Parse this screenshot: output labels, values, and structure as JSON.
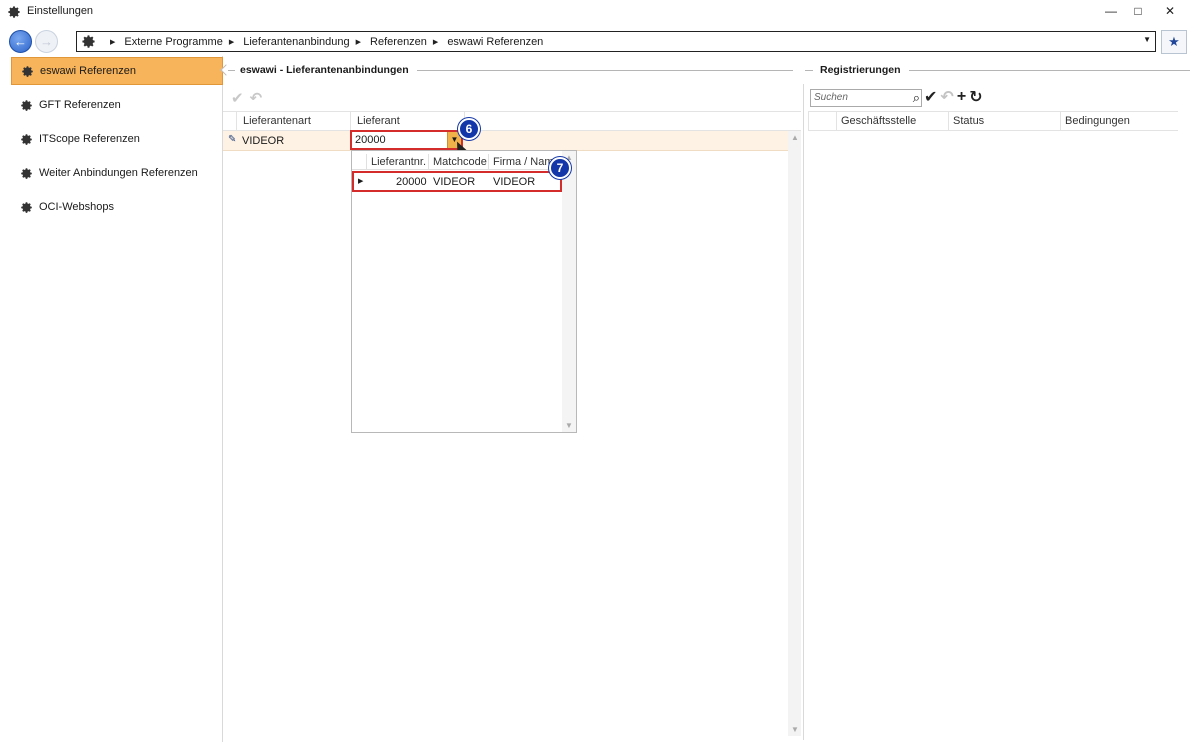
{
  "window": {
    "title": "Einstellungen",
    "minimize": "—",
    "maximize": "□",
    "close": "✕"
  },
  "nav": {
    "back_symbol": "←",
    "forward_symbol": "→",
    "breadcrumb": [
      "Externe Programme",
      "Lieferantenanbindung",
      "Referenzen",
      "eswawi Referenzen"
    ],
    "separator": "▶",
    "dropdown_symbol": "▼",
    "favorite_symbol": "★"
  },
  "sidebar": {
    "items": [
      {
        "label": "eswawi Referenzen",
        "active": true
      },
      {
        "label": "GFT Referenzen",
        "active": false
      },
      {
        "label": "ITScope Referenzen",
        "active": false
      },
      {
        "label": "Weiter Anbindungen Referenzen",
        "active": false
      },
      {
        "label": "OCI-Webshops",
        "active": false
      }
    ]
  },
  "left_section": {
    "title": "eswawi - Lieferantenanbindungen",
    "toolbar": {
      "apply_symbol": "✔",
      "undo_symbol": "↶"
    },
    "columns": [
      "Lieferantenart",
      "Lieferant"
    ],
    "row": {
      "edit_symbol": "✎",
      "lieferantenart": "VIDEOR",
      "lieferant_input": "20000"
    },
    "combo_button_symbol": "▼",
    "dropdown": {
      "columns": [
        "Lieferantnr.",
        "Matchcode",
        "Firma / Name"
      ],
      "rows": [
        {
          "lieferantnr": "20000",
          "matchcode": "VIDEOR",
          "firma": "VIDEOR"
        }
      ]
    },
    "scroll": {
      "up": "▲",
      "down": "▼"
    }
  },
  "right_section": {
    "title": "Registrierungen",
    "search_placeholder": "Suchen",
    "search_icon_symbol": "⌕",
    "toolbar": {
      "apply_symbol": "✔",
      "undo_symbol": "↶",
      "add_symbol": "+",
      "refresh_symbol": "↻"
    },
    "columns": [
      "Geschäftsstelle",
      "Status",
      "Bedingungen"
    ]
  },
  "badges": {
    "step6": "6",
    "step7": "7"
  },
  "colors": {
    "active_item": "#f7b45a",
    "highlight_red": "#d42b2b",
    "badge_blue": "#1337a8"
  }
}
